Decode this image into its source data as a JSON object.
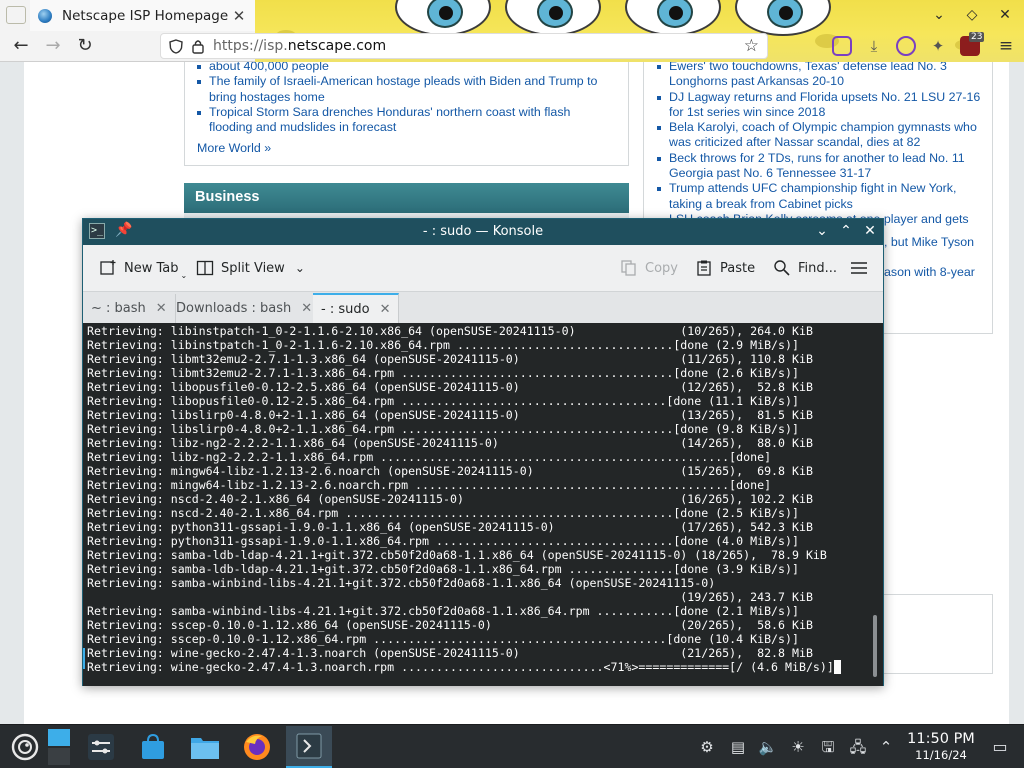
{
  "browser": {
    "tab_title": "Netscape ISP Homepage",
    "url_scheme": "https://isp.",
    "url_host": "netscape.com",
    "extension_badge": "23"
  },
  "webpage": {
    "world_news": [
      "about 400,000 people",
      "The family of Israeli-American hostage pleads with Biden and Trump to bring hostages home",
      "Tropical Storm Sara drenches Honduras' northern coast with flash flooding and mudslides in forecast"
    ],
    "world_more": "More World »",
    "business_heading": "Business",
    "sports_news": [
      "Ewers' two touchdowns, Texas' defense lead No. 3 Longhorns past Arkansas 20-10",
      "DJ Lagway returns and Florida upsets No. 21 LSU 27-16 for 1st series win since 2018",
      "Bela Karolyi, coach of Olympic champion gymnasts who was criticized after Nassar scandal, dies at 82",
      "Beck throws for 2 TDs, runs for another to lead No. 11 Georgia past No. 6 Tennessee 31-17",
      "Trump attends UFC championship fight in New York, taking a break from Cabinet picks",
      "LSU coach Brian Kelly screams at one player and gets"
    ],
    "sports_partial": [
      ", but Mike Tyson",
      "ason with 8-year"
    ]
  },
  "konsole": {
    "title": "- : sudo — Konsole",
    "toolbar": {
      "new_tab": "New Tab",
      "split_view": "Split View",
      "copy": "Copy",
      "paste": "Paste",
      "find": "Find..."
    },
    "tabs": [
      "~ : bash",
      "Downloads : bash",
      "- : sudo"
    ],
    "active_tab_index": 2,
    "terminal_lines": [
      "Retrieving: libinstpatch-1_0-2-1.1.6-2.10.x86_64 (openSUSE-20241115-0)               (10/265), 264.0 KiB",
      "Retrieving: libinstpatch-1_0-2-1.1.6-2.10.x86_64.rpm ...............................[done (2.9 MiB/s)]",
      "Retrieving: libmt32emu2-2.7.1-1.3.x86_64 (openSUSE-20241115-0)                       (11/265), 110.8 KiB",
      "Retrieving: libmt32emu2-2.7.1-1.3.x86_64.rpm .......................................[done (2.6 KiB/s)]",
      "Retrieving: libopusfile0-0.12-2.5.x86_64 (openSUSE-20241115-0)                       (12/265),  52.8 KiB",
      "Retrieving: libopusfile0-0.12-2.5.x86_64.rpm ......................................[done (11.1 KiB/s)]",
      "Retrieving: libslirp0-4.8.0+2-1.1.x86_64 (openSUSE-20241115-0)                       (13/265),  81.5 KiB",
      "Retrieving: libslirp0-4.8.0+2-1.1.x86_64.rpm .......................................[done (9.8 KiB/s)]",
      "Retrieving: libz-ng2-2.2.2-1.1.x86_64 (openSUSE-20241115-0)                          (14/265),  88.0 KiB",
      "Retrieving: libz-ng2-2.2.2-1.1.x86_64.rpm ..................................................[done]",
      "Retrieving: mingw64-libz-1.2.13-2.6.noarch (openSUSE-20241115-0)                     (15/265),  69.8 KiB",
      "Retrieving: mingw64-libz-1.2.13-2.6.noarch.rpm .............................................[done]",
      "Retrieving: nscd-2.40-2.1.x86_64 (openSUSE-20241115-0)                               (16/265), 102.2 KiB",
      "Retrieving: nscd-2.40-2.1.x86_64.rpm ...............................................[done (2.5 KiB/s)]",
      "Retrieving: python311-gssapi-1.9.0-1.1.x86_64 (openSUSE-20241115-0)                  (17/265), 542.3 KiB",
      "Retrieving: python311-gssapi-1.9.0-1.1.x86_64.rpm ..................................[done (4.0 MiB/s)]",
      "Retrieving: samba-ldb-ldap-4.21.1+git.372.cb50f2d0a68-1.1.x86_64 (openSUSE-20241115-0) (18/265),  78.9 KiB",
      "Retrieving: samba-ldb-ldap-4.21.1+git.372.cb50f2d0a68-1.1.x86_64.rpm ...............[done (3.9 KiB/s)]",
      "Retrieving: samba-winbind-libs-4.21.1+git.372.cb50f2d0a68-1.1.x86_64 (openSUSE-20241115-0)",
      "                                                                                     (19/265), 243.7 KiB",
      "Retrieving: samba-winbind-libs-4.21.1+git.372.cb50f2d0a68-1.1.x86_64.rpm ...........[done (2.1 MiB/s)]",
      "Retrieving: sscep-0.10.0-1.12.x86_64 (openSUSE-20241115-0)                           (20/265),  58.6 KiB",
      "Retrieving: sscep-0.10.0-1.12.x86_64.rpm ..........................................[done (10.4 KiB/s)]",
      "Retrieving: wine-gecko-2.47.4-1.3.noarch (openSUSE-20241115-0)                       (21/265),  82.8 MiB",
      "Retrieving: wine-gecko-2.47.4-1.3.noarch.rpm .............................<71%>=============[/ (4.6 MiB/s)]"
    ]
  },
  "taskbar": {
    "time": "11:50 PM",
    "date": "11/16/24"
  },
  "colors": {
    "konsole_titlebar": "#1f4f5e",
    "terminal_bg": "#232627",
    "link_blue": "#1458a6",
    "section_teal": "#2c6d78",
    "taskbar_bg": "#282c2f",
    "accent": "#3daee9"
  }
}
